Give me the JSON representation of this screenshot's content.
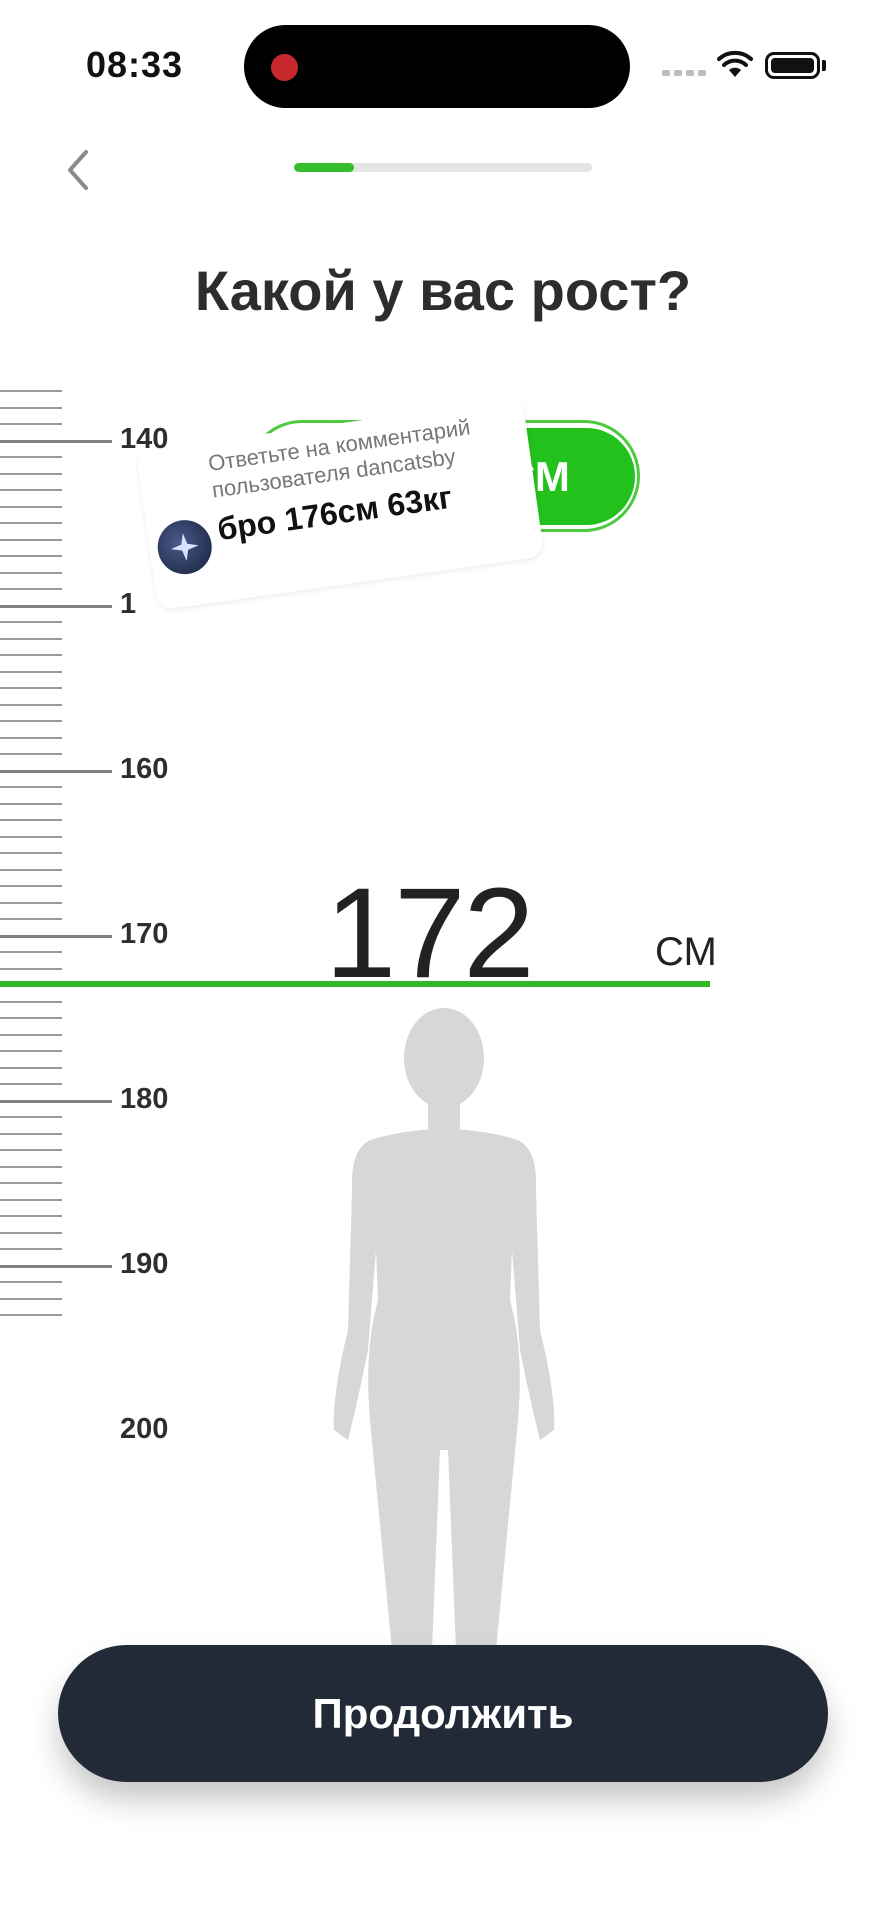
{
  "status_bar": {
    "time": "08:33"
  },
  "nav": {
    "back_icon": "chevron-left-icon",
    "progress": 0.2
  },
  "question": {
    "title": "Какой у вас рост?"
  },
  "unit_toggle": {
    "selected": "СМ"
  },
  "comment_sticker": {
    "subtitle_line1": "Ответьте на комментарий",
    "subtitle_line2": "пользователя dancatsby",
    "text": "бро 176см 63кг",
    "avatar_icon": "sparkle-icon"
  },
  "ruler": {
    "labels": [
      "140",
      "1",
      "160",
      "170",
      "180",
      "190",
      "200"
    ]
  },
  "height": {
    "value": "172",
    "unit": "СМ"
  },
  "actions": {
    "continue_label": "Продолжить"
  },
  "colors": {
    "accent": "#22c11b",
    "button": "#232a37",
    "silhouette": "#d6d8d6"
  }
}
